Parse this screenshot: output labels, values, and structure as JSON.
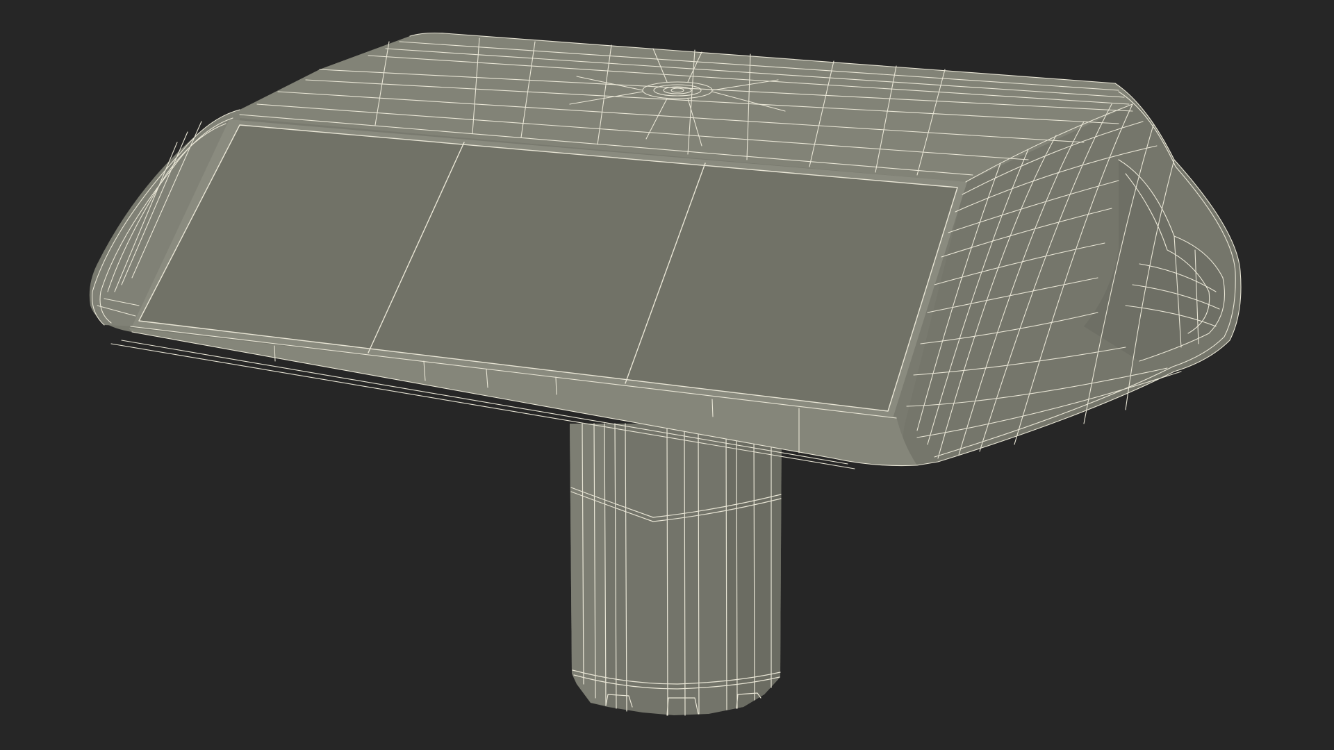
{
  "scene": {
    "subject": "",
    "colors": {
      "background": "#262626",
      "surface": "#7a7b70",
      "surface_light": "#86877b",
      "surface_dark": "#66675d",
      "screen": "#727368",
      "wireframe": "#e9e6d6"
    }
  }
}
